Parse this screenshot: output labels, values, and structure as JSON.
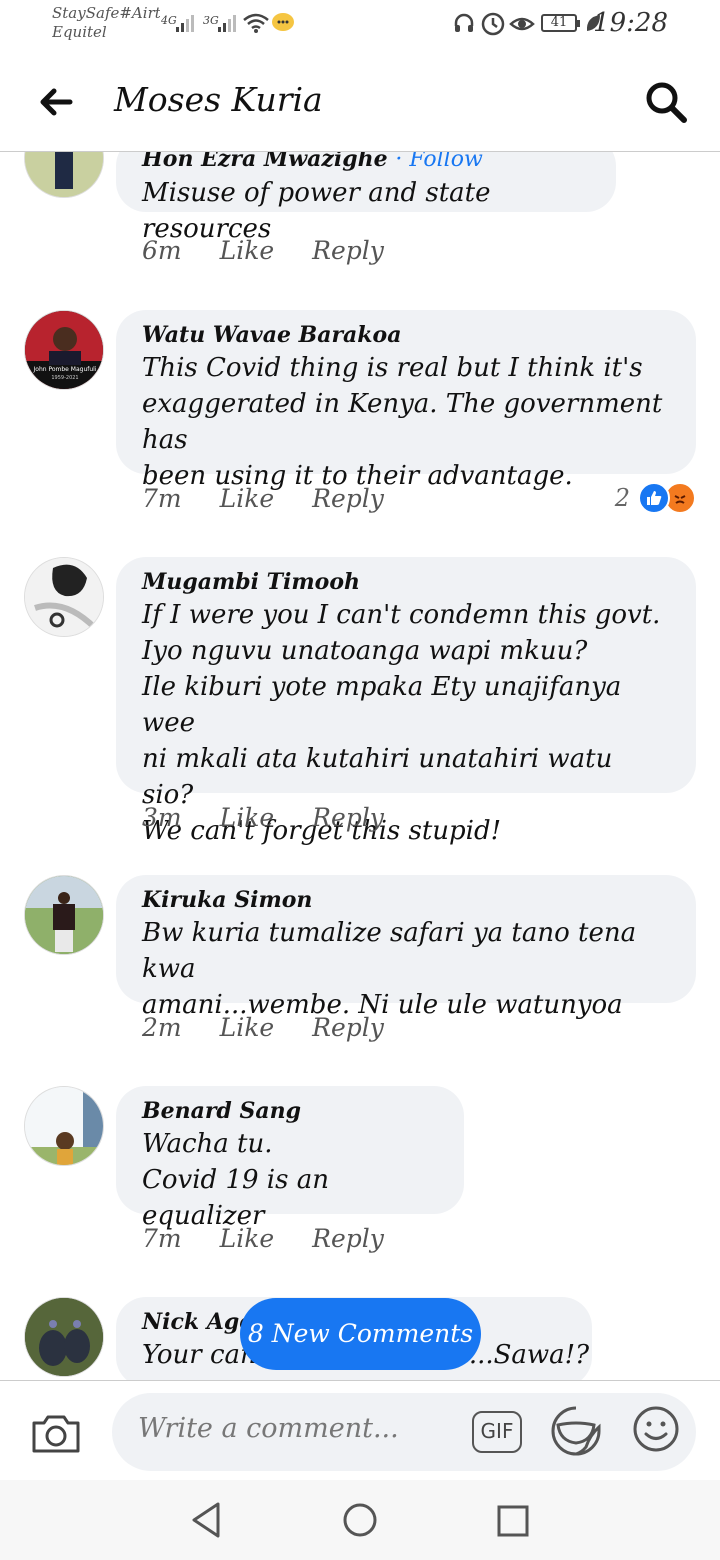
{
  "status_bar": {
    "carrier_line1": "StaySafe#Airtel",
    "carrier_line2": "Equitel",
    "net1": "4G",
    "net2": "3G",
    "battery": "41",
    "time": "19:28"
  },
  "header": {
    "title": "Moses Kuria"
  },
  "comments": [
    {
      "author": "Hon Ezra Mwazighe",
      "follow": "· Follow",
      "text": "Misuse of power and state resources",
      "time": "6m",
      "like": "Like",
      "reply": "Reply"
    },
    {
      "author": "Watu Wavae Barakoa",
      "avatar_caption": "John Pombe Magufuli",
      "avatar_years": "1959-2021",
      "text": "This Covid thing is real but I think it's\nexaggerated in Kenya. The government has\nbeen using it to their advantage.",
      "time": "7m",
      "like": "Like",
      "reply": "Reply",
      "reaction_count": "2"
    },
    {
      "author": "Mugambi Timooh",
      "text": "If I were you I can't condemn this govt.\nIyo nguvu unatoanga wapi mkuu?\nIle kiburi yote mpaka Ety  unajifanya wee\nni mkali ata kutahiri unatahiri watu sio?\nWe can't forget this stupid!",
      "time": "3m",
      "like": "Like",
      "reply": "Reply"
    },
    {
      "author": "Kiruka Simon",
      "text": "Bw kuria tumalize safari ya tano tena kwa\namani...wembe. Ni ule ule watunyoa",
      "time": "2m",
      "like": "Like",
      "reply": "Reply"
    },
    {
      "author": "Benard Sang",
      "text": "Wacha tu.\nCovid 19 is an equalizer",
      "time": "7m",
      "like": "Like",
      "reply": "Reply"
    },
    {
      "author": "Nick Ago",
      "text": "Your can",
      "text_end": "...Sawa!?"
    }
  ],
  "new_comments": "8 New Comments",
  "composer": {
    "placeholder": "Write a comment...",
    "gif_label": "GIF"
  },
  "icons": {
    "back": "back-arrow-icon",
    "search": "search-icon",
    "camera": "camera-icon",
    "sticker": "sticker-icon",
    "emoji": "emoji-icon"
  },
  "colors": {
    "accent": "#1877f2",
    "bubble": "#f0f2f5",
    "angry": "#f37a1f"
  }
}
